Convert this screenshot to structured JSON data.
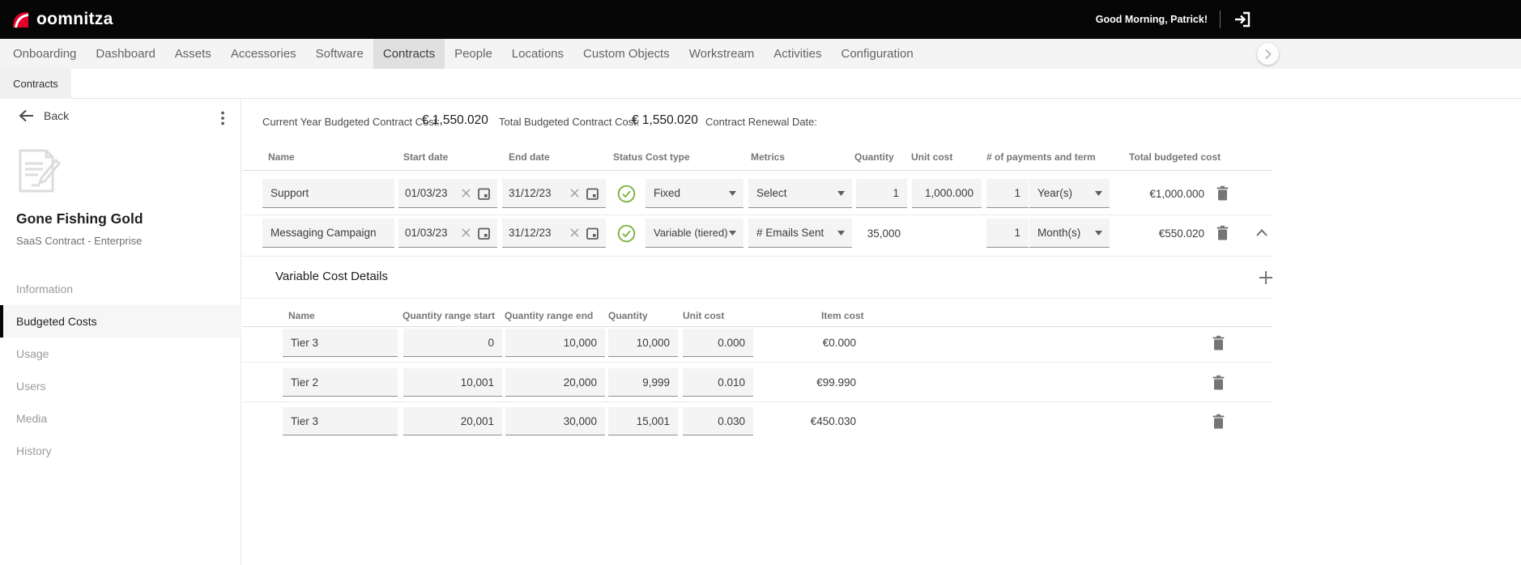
{
  "branding": {
    "logo_text": "oomnitza"
  },
  "topbar": {
    "greeting": "Good Morning, Patrick!"
  },
  "nav": {
    "items": [
      "Onboarding",
      "Dashboard",
      "Assets",
      "Accessories",
      "Software",
      "Contracts",
      "People",
      "Locations",
      "Custom Objects",
      "Workstream",
      "Activities",
      "Configuration"
    ],
    "active_item": "Contracts"
  },
  "subtab": {
    "label": "Contracts"
  },
  "sidebar": {
    "back_label": "Back",
    "title": "Gone Fishing Gold",
    "subtitle": "SaaS Contract - Enterprise",
    "menu": [
      "Information",
      "Budgeted Costs",
      "Usage",
      "Users",
      "Media",
      "History"
    ],
    "active_item": "Budgeted Costs"
  },
  "summary": {
    "items": [
      {
        "label": "Current Year Budgeted Contract Cost:",
        "value": "€ 1,550.020"
      },
      {
        "label": "Total Budgeted Contract Cost:",
        "value": "€ 1,550.020"
      },
      {
        "label": "Contract Renewal Date:",
        "value": ""
      }
    ]
  },
  "budget_table": {
    "headers": [
      "Name",
      "Start date",
      "End date",
      "Status",
      "Cost type",
      "Metrics",
      "Quantity",
      "Unit cost",
      "# of payments and term",
      "Total budgeted cost"
    ],
    "rows": [
      {
        "name": "Support",
        "start_date": "01/03/23",
        "end_date": "31/12/23",
        "status": "ok",
        "cost_type": "Fixed",
        "metrics": "Select",
        "quantity": "1",
        "unit_cost": "1,000.000",
        "num_payments": "1",
        "term": "Year(s)",
        "total_budgeted_cost": "€1,000.000"
      },
      {
        "name": "Messaging Campaign",
        "start_date": "01/03/23",
        "end_date": "31/12/23",
        "status": "ok",
        "cost_type": "Variable (tiered)",
        "metrics": "# Emails Sent",
        "quantity": "35,000",
        "unit_cost": "",
        "num_payments": "1",
        "term": "Month(s)",
        "total_budgeted_cost": "€550.020",
        "expanded": true
      }
    ]
  },
  "variable_section": {
    "title": "Variable Cost Details",
    "headers": [
      "Name",
      "Quantity range start",
      "Quantity range end",
      "Quantity",
      "Unit cost",
      "Item cost"
    ],
    "rows": [
      {
        "name": "Tier 3",
        "range_start": "0",
        "range_end": "10,000",
        "quantity": "10,000",
        "unit_cost": "0.000",
        "item_cost": "€0.000"
      },
      {
        "name": "Tier 2",
        "range_start": "10,001",
        "range_end": "20,000",
        "quantity": "9,999",
        "unit_cost": "0.010",
        "item_cost": "€99.990"
      },
      {
        "name": "Tier 3",
        "range_start": "20,001",
        "range_end": "30,000",
        "quantity": "15,001",
        "unit_cost": "0.030",
        "item_cost": "€450.030"
      }
    ]
  },
  "icons": {
    "logo": "red-swoosh",
    "logout": "arrow-into-bracket",
    "back": "arrow-left",
    "more": "kebab-vertical",
    "contract": "document-pencil",
    "clear": "x",
    "calendar": "calendar",
    "status_ok": "check-circle",
    "dropdown": "chevron-down",
    "delete": "trash",
    "add": "plus",
    "collapse": "chevron-up",
    "nav_overflow": "chevron-right"
  },
  "colors": {
    "topbar_bg": "#060606",
    "accent_red": "#e4002b",
    "status_green": "#7cb342",
    "active_tab_bg": "#e0e0e0"
  }
}
